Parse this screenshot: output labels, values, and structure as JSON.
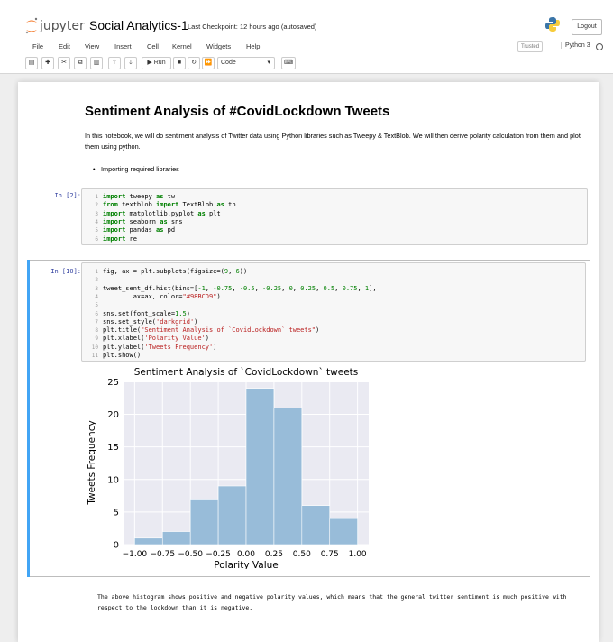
{
  "header": {
    "logo_text": "jupyter",
    "notebook_name": "Social Analytics-1",
    "checkpoint": "Last Checkpoint: 12 hours ago  (autosaved)",
    "logout_label": "Logout"
  },
  "menu": [
    "File",
    "Edit",
    "View",
    "Insert",
    "Cell",
    "Kernel",
    "Widgets",
    "Help"
  ],
  "status": {
    "trusted": "Trusted",
    "kernel": "Python 3"
  },
  "toolbar": {
    "run_label": "Run",
    "cell_type": "Code"
  },
  "cells": {
    "title": "Sentiment Analysis of #CovidLockdown Tweets",
    "intro": "In this notebook, we will do sentiment analysis of Twitter data using Python libraries such as Tweepy & TextBlob. We will then derive polarity calculation from them and plot them using python.",
    "bullet": "Importing required libraries",
    "prompt1": "In [2]:",
    "prompt2": "In [10]:",
    "outro": "The above histogram shows positive and negative polarity values, which means that the general twitter sentiment is much positive with respect to the lockdown than it is negative."
  },
  "code1": [
    "import tweepy as tw",
    "from textblob import TextBlob as tb",
    "import matplotlib.pyplot as plt",
    "import seaborn as sns",
    "import pandas as pd",
    "import re"
  ],
  "code2": [
    "fig, ax = plt.subplots(figsize=(9, 6))",
    "",
    "tweet_sent_df.hist(bins=[-1, -0.75, -0.5, -0.25, 0, 0.25, 0.5, 0.75, 1],",
    "        ax=ax, color=\"#98BCD9\")",
    "",
    "sns.set(font_scale=1.5)",
    "sns.set_style('darkgrid')",
    "plt.title(\"Sentiment Analysis of `CovidLockdown` tweets\")",
    "plt.xlabel('Polarity Value')",
    "plt.ylabel('Tweets Frequency')",
    "plt.show()"
  ],
  "chart_data": {
    "type": "bar",
    "title": "Sentiment Analysis of `CovidLockdown` tweets",
    "xlabel": "Polarity Value",
    "ylabel": "Tweets Frequency",
    "bins": [
      -1,
      -0.75,
      -0.5,
      -0.25,
      0,
      0.25,
      0.5,
      0.75,
      1
    ],
    "values": [
      1,
      2,
      7,
      9,
      24,
      21,
      6,
      4
    ],
    "xticks": [
      "−1.00",
      "−0.75",
      "−0.50",
      "−0.25",
      "0.00",
      "0.25",
      "0.50",
      "0.75",
      "1.00"
    ],
    "yticks": [
      "0",
      "5",
      "10",
      "15",
      "20",
      "25"
    ],
    "xlim": [
      -1.1,
      1.1
    ],
    "ylim": [
      0,
      25.2
    ],
    "grid": true,
    "bar_color": "#98BCD9",
    "background": "#EAEAF2"
  }
}
